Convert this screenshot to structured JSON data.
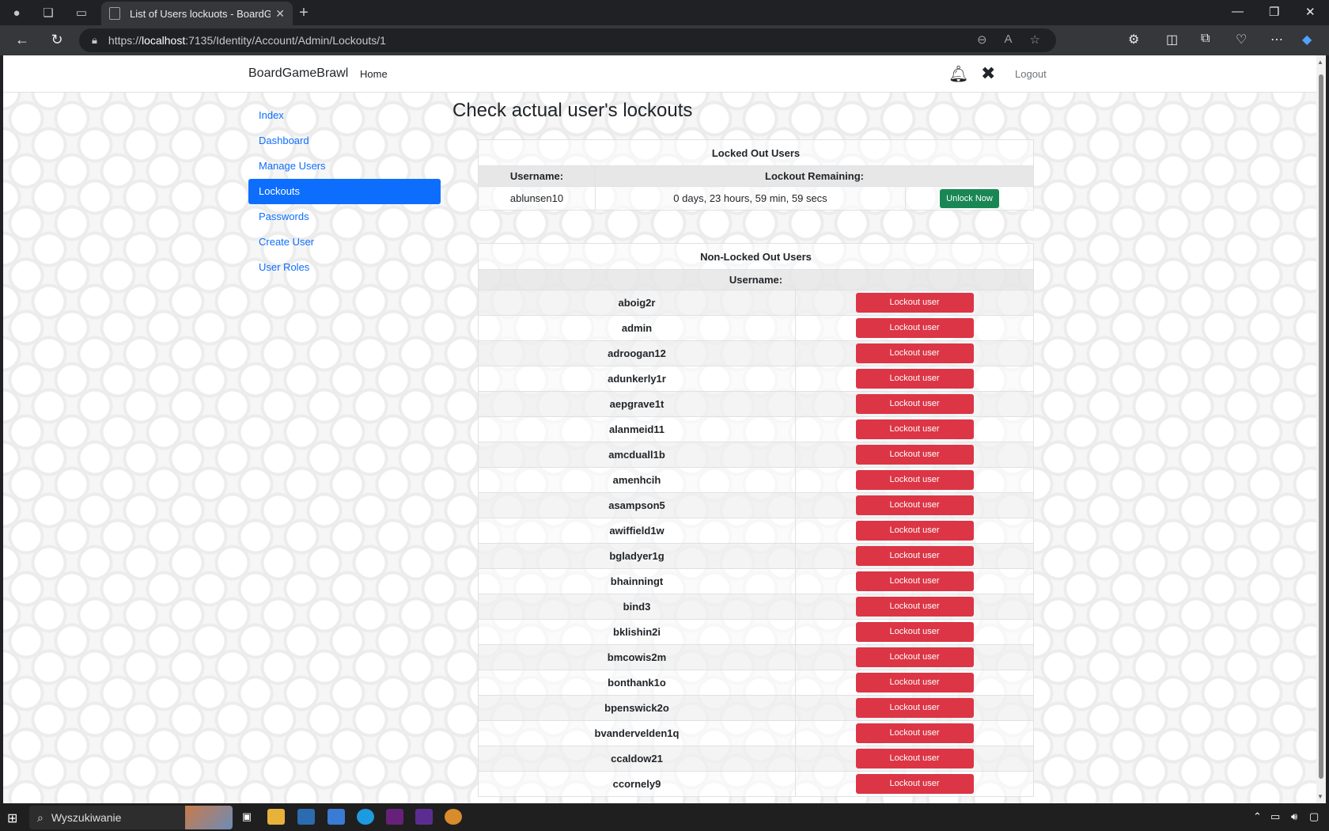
{
  "browser": {
    "tab_title": "List of Users lockuots - BoardGar",
    "tab_close": "✕",
    "new_tab": "+",
    "url_prefix": "https://",
    "url_host": "localhost",
    "url_rest": ":7135/Identity/Account/Admin/Lockouts/1",
    "win_minimize": "—",
    "win_restore": "❐",
    "win_close": "✕"
  },
  "navbar": {
    "brand": "BoardGameBrawl",
    "home": "Home",
    "logout": "Logout"
  },
  "sidebar": {
    "items": [
      {
        "label": "Index"
      },
      {
        "label": "Dashboard"
      },
      {
        "label": "Manage Users"
      },
      {
        "label": "Lockouts"
      },
      {
        "label": "Passwords"
      },
      {
        "label": "Create User"
      },
      {
        "label": "User Roles"
      }
    ]
  },
  "main": {
    "heading": "Check actual user's lockouts",
    "locked": {
      "caption": "Locked Out Users",
      "col_username": "Username:",
      "col_remaining": "Lockout Remaining:",
      "rows": [
        {
          "username": "ablunsen10",
          "remaining": "0 days, 23 hours, 59 min, 59 secs",
          "action": "Unlock Now"
        }
      ]
    },
    "nonlocked": {
      "caption": "Non-Locked Out Users",
      "col_username": "Username:",
      "action_label": "Lockout user",
      "users": [
        "aboig2r",
        "admin",
        "adroogan12",
        "adunkerly1r",
        "aepgrave1t",
        "alanmeid11",
        "amcduall1b",
        "amenhcih",
        "asampson5",
        "awiffield1w",
        "bgladyer1g",
        "bhainningt",
        "bind3",
        "bklishin2i",
        "bmcowis2m",
        "bonthank1o",
        "bpenswick2o",
        "bvandervelden1q",
        "ccaldow21",
        "ccornely9"
      ]
    }
  },
  "taskbar": {
    "search_placeholder": "Wyszukiwanie"
  },
  "colors": {
    "primary": "#0d6efd",
    "success": "#198754",
    "danger": "#dc3545"
  }
}
